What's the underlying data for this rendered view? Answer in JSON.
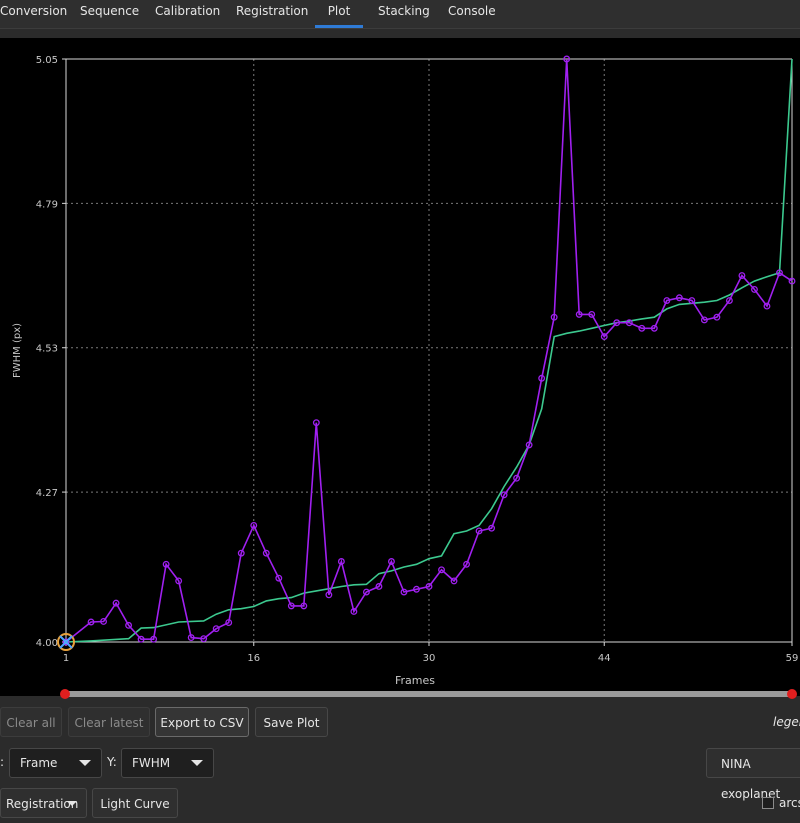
{
  "tabs": [
    {
      "label": "Conversion"
    },
    {
      "label": "Sequence"
    },
    {
      "label": "Calibration"
    },
    {
      "label": "Registration"
    },
    {
      "label": "Plot",
      "active": true
    },
    {
      "label": "Stacking"
    },
    {
      "label": "Console"
    }
  ],
  "colors": {
    "accent": "#2f7bd6",
    "series_fwhm": "#a020f0",
    "series_trend": "#3cc98f",
    "grid": "#7a7a7a",
    "slider_handle": "#e01f1f"
  },
  "chart_data": {
    "type": "line",
    "xlabel": "Frames",
    "ylabel": "FWHM (px)",
    "xlim": [
      1,
      59
    ],
    "ylim": [
      4.0,
      5.05
    ],
    "x_ticks": [
      1,
      16,
      30,
      44,
      59
    ],
    "y_ticks": [
      4.0,
      4.27,
      4.53,
      4.79,
      5.05
    ],
    "grid": true,
    "series": [
      {
        "key": "fwhm",
        "markers": true,
        "points": [
          [
            1,
            4.0
          ],
          [
            3,
            4.036
          ],
          [
            4,
            4.037
          ],
          [
            5,
            4.07
          ],
          [
            6,
            4.03
          ],
          [
            7,
            4.005
          ],
          [
            8,
            4.005
          ],
          [
            9,
            4.14
          ],
          [
            10,
            4.11
          ],
          [
            11,
            4.008
          ],
          [
            12,
            4.006
          ],
          [
            13,
            4.024
          ],
          [
            14,
            4.035
          ],
          [
            15,
            4.16
          ],
          [
            16,
            4.21
          ],
          [
            17,
            4.16
          ],
          [
            18,
            4.115
          ],
          [
            19,
            4.065
          ],
          [
            20,
            4.065
          ],
          [
            21,
            4.395
          ],
          [
            22,
            4.085
          ],
          [
            23,
            4.145
          ],
          [
            24,
            4.055
          ],
          [
            25,
            4.09
          ],
          [
            26,
            4.1
          ],
          [
            27,
            4.145
          ],
          [
            28,
            4.09
          ],
          [
            29,
            4.095
          ],
          [
            30,
            4.1
          ],
          [
            31,
            4.13
          ],
          [
            32,
            4.11
          ],
          [
            33,
            4.14
          ],
          [
            34,
            4.2
          ],
          [
            35,
            4.205
          ],
          [
            36,
            4.265
          ],
          [
            37,
            4.295
          ],
          [
            38,
            4.355
          ],
          [
            39,
            4.475
          ],
          [
            40,
            4.585
          ],
          [
            41,
            5.05
          ],
          [
            42,
            4.59
          ],
          [
            43,
            4.59
          ],
          [
            44,
            4.55
          ],
          [
            45,
            4.575
          ],
          [
            46,
            4.575
          ],
          [
            47,
            4.565
          ],
          [
            48,
            4.565
          ],
          [
            49,
            4.615
          ],
          [
            50,
            4.62
          ],
          [
            51,
            4.615
          ],
          [
            52,
            4.58
          ],
          [
            53,
            4.585
          ],
          [
            54,
            4.615
          ],
          [
            55,
            4.66
          ],
          [
            56,
            4.635
          ],
          [
            57,
            4.605
          ],
          [
            58,
            4.665
          ],
          [
            59,
            4.65
          ]
        ]
      },
      {
        "key": "trend",
        "markers": false,
        "points": [
          [
            1,
            4.0
          ],
          [
            3,
            4.002
          ],
          [
            6,
            4.006
          ],
          [
            7,
            4.025
          ],
          [
            8,
            4.026
          ],
          [
            10,
            4.036
          ],
          [
            12,
            4.038
          ],
          [
            13,
            4.05
          ],
          [
            14,
            4.058
          ],
          [
            15,
            4.06
          ],
          [
            16,
            4.064
          ],
          [
            17,
            4.074
          ],
          [
            18,
            4.078
          ],
          [
            19,
            4.08
          ],
          [
            20,
            4.088
          ],
          [
            21,
            4.092
          ],
          [
            23,
            4.1
          ],
          [
            24,
            4.103
          ],
          [
            25,
            4.104
          ],
          [
            26,
            4.123
          ],
          [
            27,
            4.128
          ],
          [
            28,
            4.135
          ],
          [
            29,
            4.14
          ],
          [
            30,
            4.15
          ],
          [
            31,
            4.155
          ],
          [
            32,
            4.195
          ],
          [
            33,
            4.2
          ],
          [
            34,
            4.21
          ],
          [
            35,
            4.24
          ],
          [
            36,
            4.28
          ],
          [
            37,
            4.315
          ],
          [
            38,
            4.355
          ],
          [
            39,
            4.42
          ],
          [
            40,
            4.55
          ],
          [
            41,
            4.556
          ],
          [
            42,
            4.56
          ],
          [
            43,
            4.565
          ],
          [
            44,
            4.57
          ],
          [
            45,
            4.575
          ],
          [
            46,
            4.578
          ],
          [
            47,
            4.582
          ],
          [
            48,
            4.585
          ],
          [
            49,
            4.6
          ],
          [
            50,
            4.608
          ],
          [
            51,
            4.61
          ],
          [
            52,
            4.612
          ],
          [
            53,
            4.615
          ],
          [
            54,
            4.625
          ],
          [
            55,
            4.638
          ],
          [
            56,
            4.65
          ],
          [
            57,
            4.658
          ],
          [
            58,
            4.665
          ],
          [
            59,
            5.05
          ]
        ]
      }
    ]
  },
  "slider": {
    "min_value": 1,
    "max_value": 59
  },
  "buttons": {
    "clear_all": "Clear all",
    "clear_latest": "Clear latest",
    "export_csv": "Export to CSV",
    "save_plot": "Save Plot",
    "nina_exoplanet": "NINA exoplanet",
    "registration": "Registration",
    "light_curve": "Light Curve"
  },
  "legend_label": "legen",
  "axes_controls": {
    "x_prefix": ":",
    "x_value": "Frame",
    "y_prefix": "Y:",
    "y_value": "FWHM"
  },
  "arcsec_label": "arcs"
}
